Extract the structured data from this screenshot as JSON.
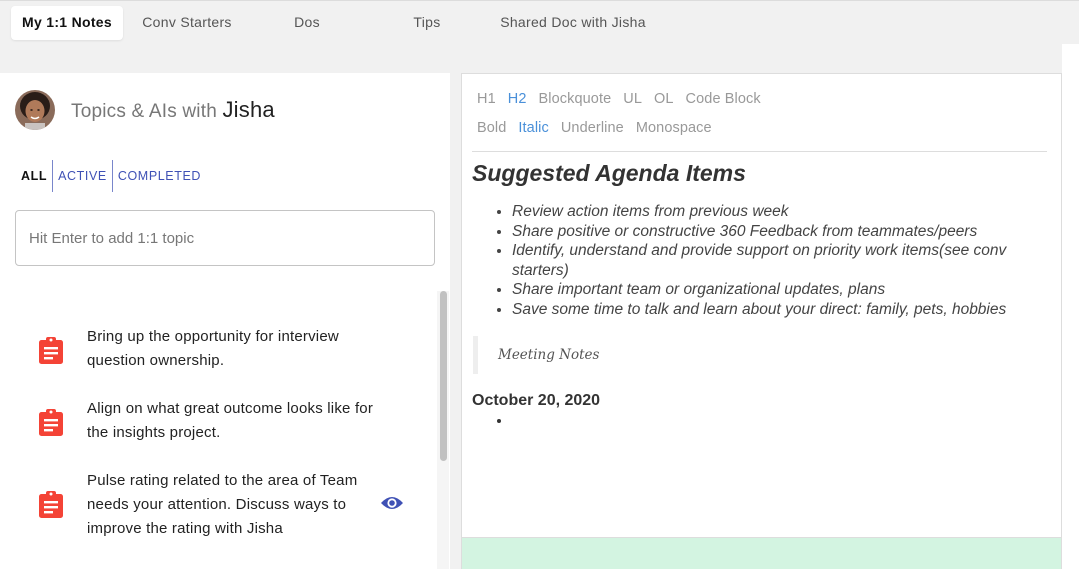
{
  "tabs": [
    {
      "label": "My 1:1 Notes",
      "active": true
    },
    {
      "label": "Conv Starters",
      "active": false
    },
    {
      "label": "Dos",
      "active": false
    },
    {
      "label": "Tips",
      "active": false
    },
    {
      "label": "Shared Doc with Jisha",
      "active": false
    }
  ],
  "panel": {
    "title_prefix": "Topics & AIs with",
    "name": "Jisha",
    "filters": [
      "ALL",
      "ACTIVE",
      "COMPLETED"
    ],
    "active_filter": "ALL",
    "input_placeholder": "Hit Enter to add 1:1 topic"
  },
  "topics": [
    {
      "text": "Bring up the opportunity for interview question ownership.",
      "icon": "clipboard-alert-icon",
      "has_eye": false
    },
    {
      "text": "Align on what great outcome looks like for the insights project.",
      "icon": "clipboard-alert-icon",
      "has_eye": false
    },
    {
      "text": "Pulse rating related to the area of Team needs your attention. Discuss ways to improve the rating with Jisha",
      "icon": "clipboard-alert-icon",
      "has_eye": true
    }
  ],
  "toolbar": {
    "row1": [
      "H1",
      "H2",
      "Blockquote",
      "UL",
      "OL",
      "Code Block"
    ],
    "row2": [
      "Bold",
      "Italic",
      "Underline",
      "Monospace"
    ],
    "active": [
      "H2",
      "Italic"
    ]
  },
  "doc": {
    "heading": "Suggested Agenda Items",
    "agenda": [
      "Review action items from previous week",
      "Share positive or constructive 360 Feedback from teammates/peers",
      "Identify, understand and provide support on priority work items(see conv starters)",
      "Share important team or organizational updates, plans",
      "Save some time to talk and learn about your direct: family, pets, hobbies"
    ],
    "blockquote": "Meeting Notes",
    "date_heading": "October 20, 2020"
  },
  "colors": {
    "accent": "#3f51b5",
    "toolbar_active": "#4a90d9",
    "clipboard": "#f44336",
    "footer_band": "#d3f4e1"
  }
}
